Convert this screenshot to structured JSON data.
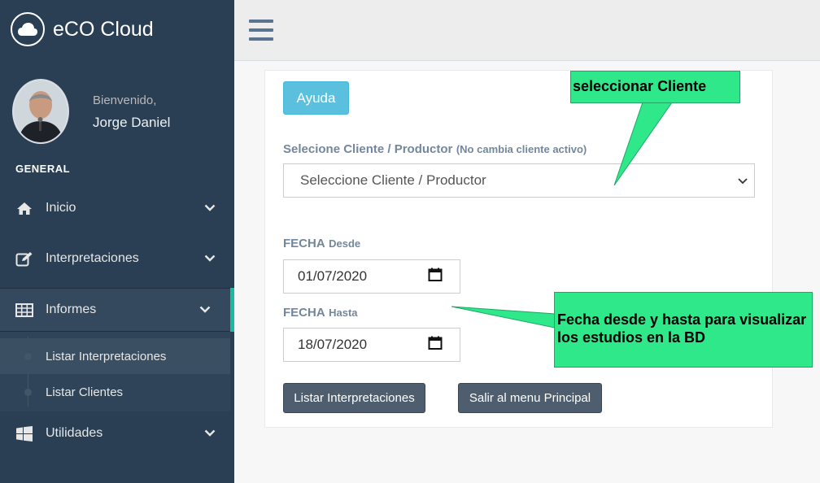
{
  "brand": {
    "title": "eCO Cloud"
  },
  "profile": {
    "welcome": "Bienvenido,",
    "name": "Jorge Daniel"
  },
  "sidebar": {
    "section_title": "GENERAL",
    "items": [
      {
        "label": "Inicio",
        "icon": "home-icon"
      },
      {
        "label": "Interpretaciones",
        "icon": "edit-icon"
      },
      {
        "label": "Informes",
        "icon": "table-icon"
      },
      {
        "label": "Utilidades",
        "icon": "windows-icon"
      }
    ],
    "submenu": [
      {
        "label": "Listar Interpretaciones"
      },
      {
        "label": "Listar Clientes"
      }
    ]
  },
  "form": {
    "help_button": "Ayuda",
    "client_label": "Selecione Cliente / Productor",
    "client_note": "(No cambia cliente activo)",
    "client_select_value": "Seleccione Cliente / Productor",
    "date_from_label": "FECHA",
    "date_from_sub": "Desde",
    "date_from_value": "01/07/2020",
    "date_to_label": "FECHA",
    "date_to_sub": "Hasta",
    "date_to_value": "18/07/2020",
    "list_button": "Listar Interpretaciones",
    "exit_button": "Salir al menu Principal"
  },
  "callouts": {
    "select_client": "seleccionar Cliente",
    "dates": "Fecha desde y hasta para visualizar los estudios en la BD"
  },
  "colors": {
    "sidebar_bg": "#2a3f54",
    "accent_green": "#1abb9c",
    "help_button": "#5bc0de",
    "dark_button": "#4e5e6e",
    "callout": "#2ee88a"
  }
}
